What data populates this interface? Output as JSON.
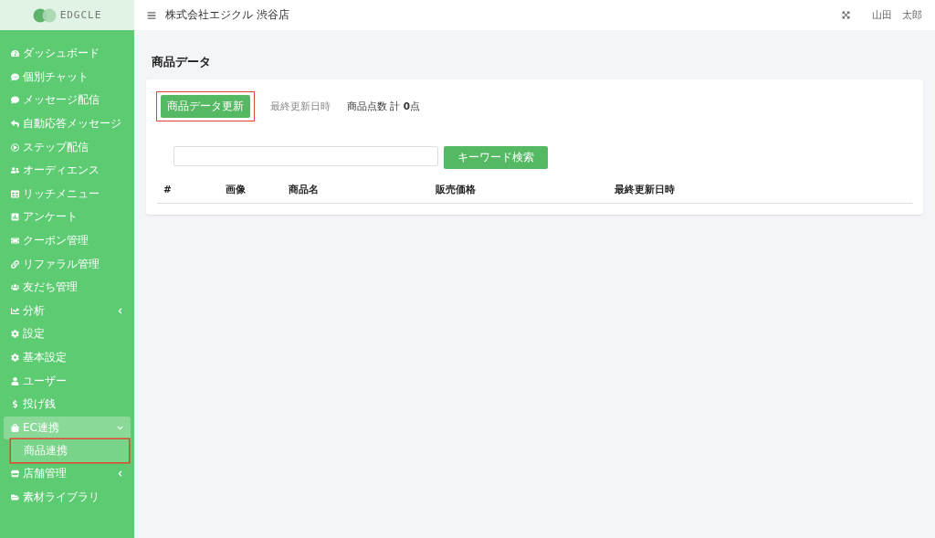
{
  "logo": {
    "text": "EDGCLE"
  },
  "header": {
    "store": "株式会社エジクル 渋谷店",
    "user": "山田　太郎"
  },
  "sidebar": {
    "items": [
      {
        "label": "ダッシュボード",
        "selected": false
      },
      {
        "label": "個別チャット",
        "selected": false
      },
      {
        "label": "メッセージ配信",
        "selected": false
      },
      {
        "label": "自動応答メッセージ",
        "selected": false
      },
      {
        "label": "ステップ配信",
        "selected": false
      },
      {
        "label": "オーディエンス",
        "selected": false
      },
      {
        "label": "リッチメニュー",
        "selected": false
      },
      {
        "label": "アンケート",
        "selected": false
      },
      {
        "label": "クーポン管理",
        "selected": false
      },
      {
        "label": "リファラル管理",
        "selected": false
      },
      {
        "label": "友だち管理",
        "selected": false
      },
      {
        "label": "分析",
        "selected": false,
        "expanded": false
      },
      {
        "label": "設定",
        "selected": false
      },
      {
        "label": "基本設定",
        "selected": false
      },
      {
        "label": "ユーザー",
        "selected": false
      },
      {
        "label": "投げ銭",
        "selected": false
      },
      {
        "label": "EC連携",
        "selected": false,
        "expanded": true,
        "children": [
          {
            "label": "商品連携",
            "selected": true,
            "annotated": true
          }
        ]
      },
      {
        "label": "店舗管理",
        "selected": false,
        "expanded": false
      },
      {
        "label": "素材ライブラリ",
        "selected": false
      }
    ]
  },
  "page": {
    "title": "商品データ",
    "update_button": {
      "label": "商品データ更新",
      "annotated": true
    },
    "last_updated_label": "最終更新日時",
    "count_label": "商品点数 計 **0**点",
    "search": {
      "button": "キーワード検索"
    },
    "table": {
      "columns": [
        "#",
        "画像",
        "商品名",
        "販売価格",
        "最終更新日時"
      ]
    }
  }
}
